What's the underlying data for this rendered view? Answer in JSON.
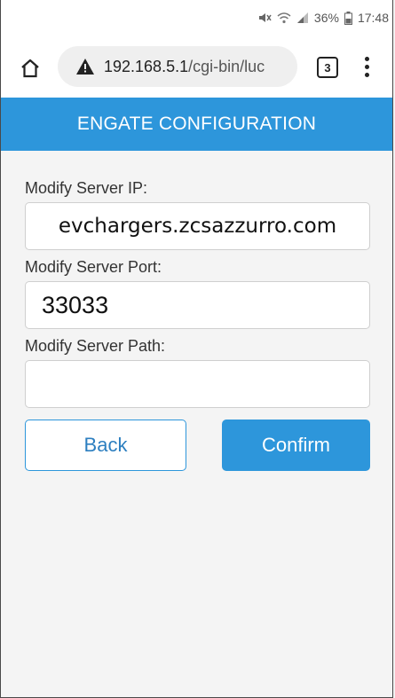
{
  "status_bar": {
    "battery": "36%",
    "time": "17:48"
  },
  "browser": {
    "url_host": "192.168.5.1",
    "url_path": "/cgi-bin/luc",
    "tab_count": "3"
  },
  "header": {
    "title": "ENGATE CONFIGURATION"
  },
  "form": {
    "server_ip_label": "Modify Server IP:",
    "server_ip_value": "evchargers.zcsazzurro.com",
    "server_port_label": "Modify Server Port:",
    "server_port_value": "33033",
    "server_path_label": "Modify Server Path:",
    "server_path_value": ""
  },
  "buttons": {
    "back_label": "Back",
    "confirm_label": "Confirm"
  },
  "colors": {
    "accent": "#2d96db",
    "background": "#f4f4f4"
  }
}
